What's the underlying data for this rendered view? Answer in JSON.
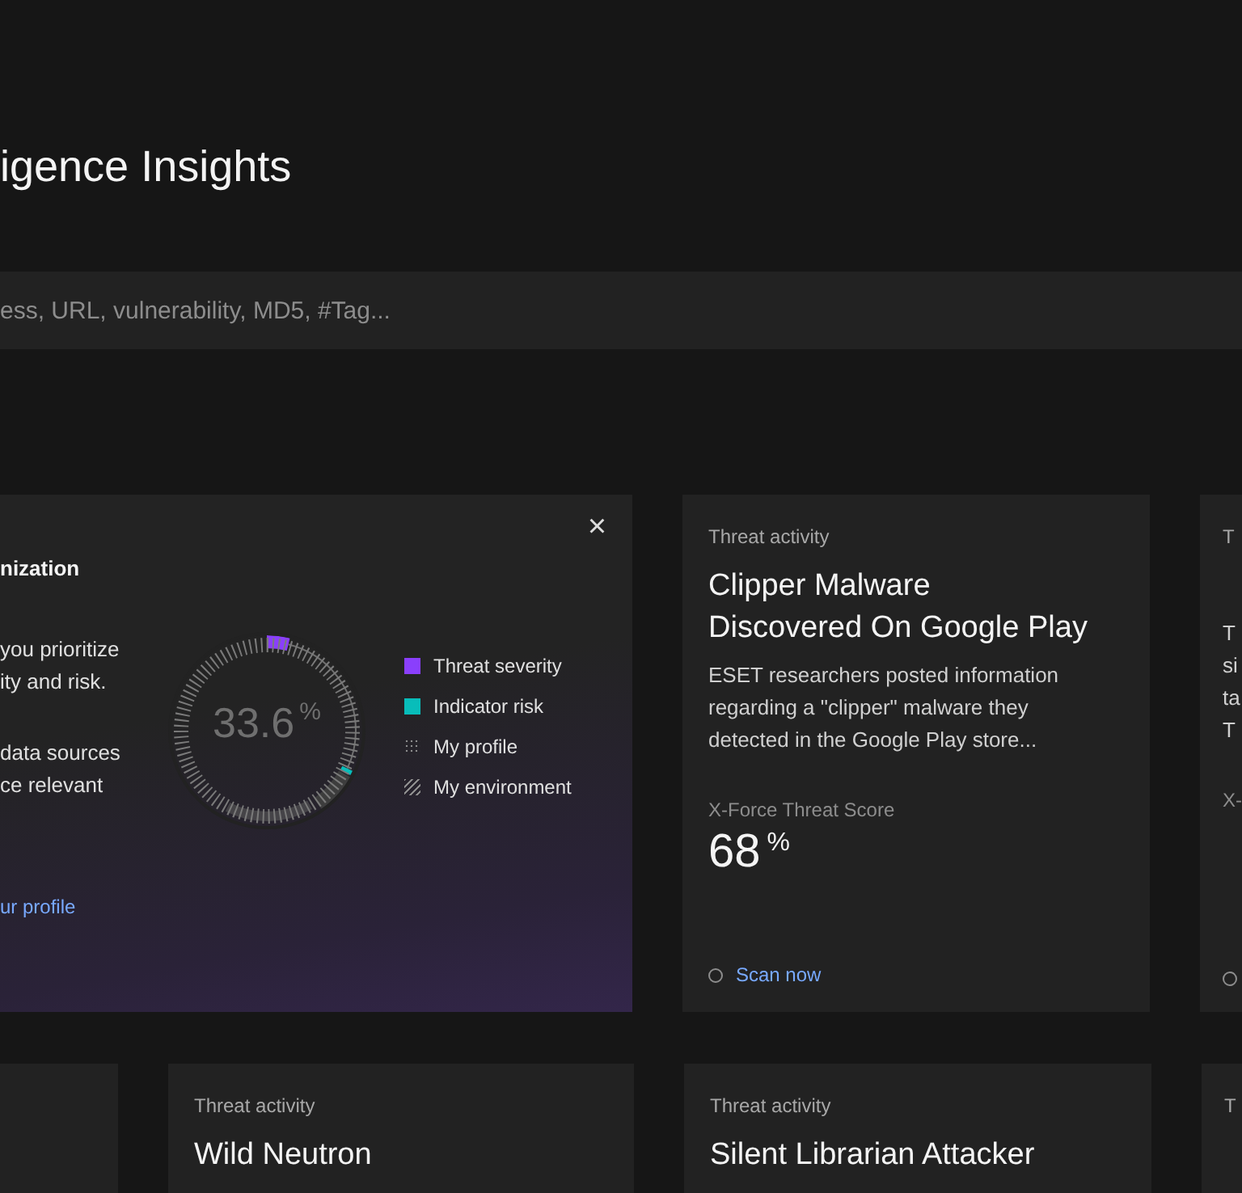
{
  "page": {
    "title": "igence Insights"
  },
  "search": {
    "placeholder": "ess, URL, vulnerability, MD5, #Tag..."
  },
  "rows": [
    {
      "cards": [
        {
          "kind": "promo",
          "heading": "nization",
          "close": "×",
          "paragraphs": [
            [
              "you prioritize",
              "ity and risk."
            ],
            [
              "data sources",
              "ce relevant"
            ]
          ],
          "chart_value": "33.6",
          "chart_unit": "%",
          "legend": [
            {
              "kind": "swatch",
              "label": "Threat severity",
              "color": "#8a3ffc"
            },
            {
              "kind": "swatch",
              "label": "Indicator risk",
              "color": "#08bdba"
            },
            {
              "kind": "dots",
              "label": "My profile"
            },
            {
              "kind": "hatch",
              "label": "My environment"
            }
          ],
          "link": "ur profile"
        },
        {
          "kind": "article",
          "label": "Threat activity",
          "title_lines": [
            "Clipper Malware",
            "Discovered On Google Play"
          ],
          "body_lines": [
            "ESET researchers posted information",
            "regarding a \"clipper\" malware they",
            "detected in the Google Play store..."
          ],
          "score_label": "X-Force Threat Score",
          "score": "68",
          "score_unit": "%",
          "action": "Scan now"
        },
        {
          "kind": "article",
          "label": "T",
          "body_lines": [
            "T",
            "si",
            "ta",
            "T"
          ],
          "score_label": "X-"
        }
      ]
    },
    {
      "cards": [
        {
          "kind": "blank"
        },
        {
          "kind": "article",
          "label": "Threat activity",
          "title_lines": [
            "Wild Neutron"
          ]
        },
        {
          "kind": "article",
          "label": "Threat activity",
          "title_lines": [
            "Silent Librarian Attacker"
          ]
        },
        {
          "kind": "article",
          "label": "T"
        }
      ]
    }
  ]
}
